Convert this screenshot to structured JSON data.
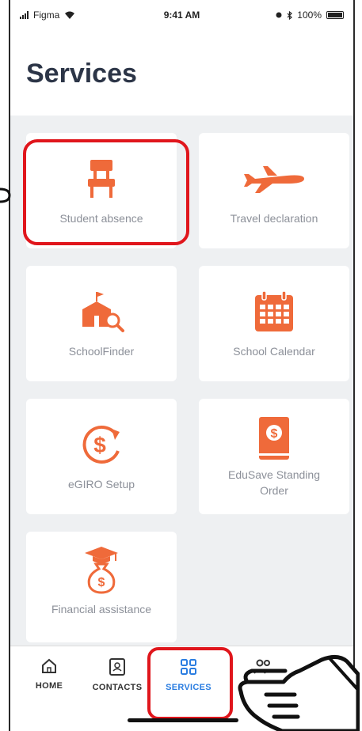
{
  "status_bar": {
    "carrier": "Figma",
    "time": "9:41 AM",
    "battery": "100%"
  },
  "header": {
    "title": "Services"
  },
  "services": [
    {
      "label": "Student absence",
      "icon": "chair-icon"
    },
    {
      "label": "Travel declaration",
      "icon": "airplane-icon"
    },
    {
      "label": "SchoolFinder",
      "icon": "school-search-icon"
    },
    {
      "label": "School Calendar",
      "icon": "calendar-icon"
    },
    {
      "label": "eGIRO Setup",
      "icon": "dollar-refresh-icon"
    },
    {
      "label": "EduSave Standing Order",
      "label_lines": [
        "EduSave Standing",
        "Order"
      ],
      "icon": "savings-book-icon"
    },
    {
      "label": "Financial assistance",
      "icon": "graduation-money-bag-icon"
    }
  ],
  "nav": {
    "items": [
      {
        "label": "HOME",
        "icon": "home-icon",
        "active": false
      },
      {
        "label": "CONTACTS",
        "icon": "contacts-book-icon",
        "active": false
      },
      {
        "label": "SERVICES",
        "icon": "grid-icon",
        "active": true
      },
      {
        "label": "",
        "icon": "people-icon",
        "active": false
      }
    ]
  },
  "colors": {
    "accent_orange": "#ef6a3a",
    "highlight_red": "#e0161c",
    "active_blue": "#2a7de1",
    "title_dark": "#2c3547",
    "background_grey": "#eef0f2"
  }
}
